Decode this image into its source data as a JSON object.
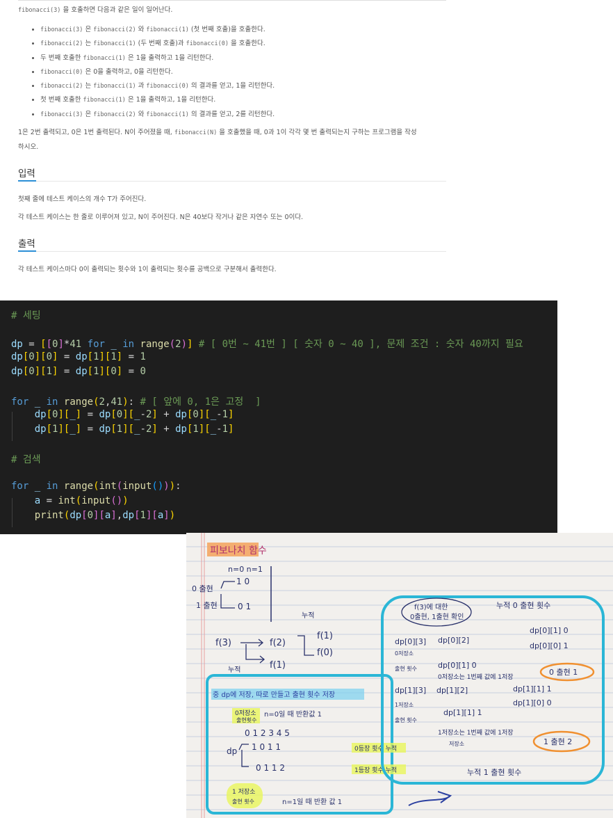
{
  "problem": {
    "intro": {
      "code": "fibonacci(3)",
      "text": " 을 호출하면 다음과 같은 일이 일어난다."
    },
    "bullets": [
      [
        {
          "c": "fibonacci(3)"
        },
        {
          "t": " 은 "
        },
        {
          "c": "fibonacci(2)"
        },
        {
          "t": " 와 "
        },
        {
          "c": "fibonacci(1)"
        },
        {
          "t": " (첫 번째 호출)을 호출한다."
        }
      ],
      [
        {
          "c": "fibonacci(2)"
        },
        {
          "t": " 는 "
        },
        {
          "c": "fibonacci(1)"
        },
        {
          "t": " (두 번째 호출)과 "
        },
        {
          "c": "fibonacci(0)"
        },
        {
          "t": " 을 호출한다."
        }
      ],
      [
        {
          "t": "두 번째 호출한 "
        },
        {
          "c": "fibonacci(1)"
        },
        {
          "t": " 은 1을 출력하고 1을 리턴한다."
        }
      ],
      [
        {
          "c": "fibonacci(0)"
        },
        {
          "t": " 은 0을 출력하고, 0을 리턴한다."
        }
      ],
      [
        {
          "c": "fibonacci(2)"
        },
        {
          "t": " 는 "
        },
        {
          "c": "fibonacci(1)"
        },
        {
          "t": " 과 "
        },
        {
          "c": "fibonacci(0)"
        },
        {
          "t": " 의 결과를 얻고, 1을 리턴한다."
        }
      ],
      [
        {
          "t": "첫 번째 호출한 "
        },
        {
          "c": "fibonacci(1)"
        },
        {
          "t": " 은 1을 출력하고, 1을 리턴한다."
        }
      ],
      [
        {
          "c": "fibonacci(3)"
        },
        {
          "t": " 은 "
        },
        {
          "c": "fibonacci(2)"
        },
        {
          "t": " 와 "
        },
        {
          "c": "fibonacci(1)"
        },
        {
          "t": " 의 결과를 얻고, 2를 리턴한다."
        }
      ]
    ],
    "summary_a": "1은 2번 출력되고, 0은 1번 출력된다. N이 주어졌을 때, ",
    "summary_code": "fibonacci(N)",
    "summary_b": " 을 호출했을 때, 0과 1이 각각 몇 번 출력되는지 구하는 프로그램을 작성",
    "summary_c": "하시오.",
    "input_heading": "입력",
    "input_line1": "첫째 줄에 테스트 케이스의 개수 T가 주어진다.",
    "input_line2": "각 테스트 케이스는 한 줄로 이루어져 있고, N이 주어진다. N은 40보다 작거나 같은 자연수 또는 0이다.",
    "output_heading": "출력",
    "output_line1": "각 테스트 케이스마다 0이 출력되는 횟수와 1이 출력되는 횟수를 공백으로 구분해서 출력한다."
  },
  "code_lines": [
    [
      {
        "k": "cm",
        "t": "# 세팅"
      }
    ],
    [],
    [
      {
        "k": "vr",
        "t": "dp"
      },
      {
        "k": "",
        "t": " = "
      },
      {
        "k": "y",
        "t": "["
      },
      {
        "k": "pk",
        "t": "["
      },
      {
        "k": "nm",
        "t": "0"
      },
      {
        "k": "pk",
        "t": "]"
      },
      {
        "k": "",
        "t": "*"
      },
      {
        "k": "nm",
        "t": "41"
      },
      {
        "k": "",
        "t": " "
      },
      {
        "k": "kw",
        "t": "for"
      },
      {
        "k": "",
        "t": " "
      },
      {
        "k": "vr",
        "t": "_"
      },
      {
        "k": "",
        "t": " "
      },
      {
        "k": "kw",
        "t": "in"
      },
      {
        "k": "",
        "t": " "
      },
      {
        "k": "fn",
        "t": "range"
      },
      {
        "k": "pk",
        "t": "("
      },
      {
        "k": "nm",
        "t": "2"
      },
      {
        "k": "pk",
        "t": ")"
      },
      {
        "k": "y",
        "t": "]"
      },
      {
        "k": "",
        "t": " "
      },
      {
        "k": "cm",
        "t": "# [ 0번 ~ 41번 ] [ 숫자 0 ~ 40 ], 문제 조건 : 숫자 40까지 필요"
      }
    ],
    [
      {
        "k": "vr",
        "t": "dp"
      },
      {
        "k": "y",
        "t": "["
      },
      {
        "k": "nm",
        "t": "0"
      },
      {
        "k": "y",
        "t": "]["
      },
      {
        "k": "nm",
        "t": "0"
      },
      {
        "k": "y",
        "t": "]"
      },
      {
        "k": "",
        "t": " = "
      },
      {
        "k": "vr",
        "t": "dp"
      },
      {
        "k": "y",
        "t": "["
      },
      {
        "k": "nm",
        "t": "1"
      },
      {
        "k": "y",
        "t": "]["
      },
      {
        "k": "nm",
        "t": "1"
      },
      {
        "k": "y",
        "t": "]"
      },
      {
        "k": "",
        "t": " = "
      },
      {
        "k": "nm",
        "t": "1"
      }
    ],
    [
      {
        "k": "vr",
        "t": "dp"
      },
      {
        "k": "y",
        "t": "["
      },
      {
        "k": "nm",
        "t": "0"
      },
      {
        "k": "y",
        "t": "]["
      },
      {
        "k": "nm",
        "t": "1"
      },
      {
        "k": "y",
        "t": "]"
      },
      {
        "k": "",
        "t": " = "
      },
      {
        "k": "vr",
        "t": "dp"
      },
      {
        "k": "y",
        "t": "["
      },
      {
        "k": "nm",
        "t": "1"
      },
      {
        "k": "y",
        "t": "]["
      },
      {
        "k": "nm",
        "t": "0"
      },
      {
        "k": "y",
        "t": "]"
      },
      {
        "k": "",
        "t": " = "
      },
      {
        "k": "nm",
        "t": "0"
      }
    ],
    [],
    [
      {
        "k": "kw",
        "t": "for"
      },
      {
        "k": "",
        "t": " "
      },
      {
        "k": "vr",
        "t": "_"
      },
      {
        "k": "",
        "t": " "
      },
      {
        "k": "kw",
        "t": "in"
      },
      {
        "k": "",
        "t": " "
      },
      {
        "k": "fn",
        "t": "range"
      },
      {
        "k": "y",
        "t": "("
      },
      {
        "k": "nm",
        "t": "2"
      },
      {
        "k": "",
        "t": ","
      },
      {
        "k": "nm",
        "t": "41"
      },
      {
        "k": "y",
        "t": ")"
      },
      {
        "k": "",
        "t": ": "
      },
      {
        "k": "cm",
        "t": "# [ 앞에 0, 1은 고정  ]"
      }
    ],
    [
      {
        "k": "",
        "t": "    "
      },
      {
        "k": "vr",
        "t": "dp"
      },
      {
        "k": "y",
        "t": "["
      },
      {
        "k": "nm",
        "t": "0"
      },
      {
        "k": "y",
        "t": "]["
      },
      {
        "k": "vr",
        "t": "_"
      },
      {
        "k": "y",
        "t": "]"
      },
      {
        "k": "",
        "t": " = "
      },
      {
        "k": "vr",
        "t": "dp"
      },
      {
        "k": "y",
        "t": "["
      },
      {
        "k": "nm",
        "t": "0"
      },
      {
        "k": "y",
        "t": "]["
      },
      {
        "k": "vr",
        "t": "_"
      },
      {
        "k": "",
        "t": "-"
      },
      {
        "k": "nm",
        "t": "2"
      },
      {
        "k": "y",
        "t": "]"
      },
      {
        "k": "",
        "t": " + "
      },
      {
        "k": "vr",
        "t": "dp"
      },
      {
        "k": "y",
        "t": "["
      },
      {
        "k": "nm",
        "t": "0"
      },
      {
        "k": "y",
        "t": "]["
      },
      {
        "k": "vr",
        "t": "_"
      },
      {
        "k": "",
        "t": "-"
      },
      {
        "k": "nm",
        "t": "1"
      },
      {
        "k": "y",
        "t": "]"
      }
    ],
    [
      {
        "k": "",
        "t": "    "
      },
      {
        "k": "vr",
        "t": "dp"
      },
      {
        "k": "y",
        "t": "["
      },
      {
        "k": "nm",
        "t": "1"
      },
      {
        "k": "y",
        "t": "]["
      },
      {
        "k": "vr",
        "t": "_"
      },
      {
        "k": "y",
        "t": "]"
      },
      {
        "k": "",
        "t": " = "
      },
      {
        "k": "vr",
        "t": "dp"
      },
      {
        "k": "y",
        "t": "["
      },
      {
        "k": "nm",
        "t": "1"
      },
      {
        "k": "y",
        "t": "]["
      },
      {
        "k": "vr",
        "t": "_"
      },
      {
        "k": "",
        "t": "-"
      },
      {
        "k": "nm",
        "t": "2"
      },
      {
        "k": "y",
        "t": "]"
      },
      {
        "k": "",
        "t": " + "
      },
      {
        "k": "vr",
        "t": "dp"
      },
      {
        "k": "y",
        "t": "["
      },
      {
        "k": "nm",
        "t": "1"
      },
      {
        "k": "y",
        "t": "]["
      },
      {
        "k": "vr",
        "t": "_"
      },
      {
        "k": "",
        "t": "-"
      },
      {
        "k": "nm",
        "t": "1"
      },
      {
        "k": "y",
        "t": "]"
      }
    ],
    [],
    [
      {
        "k": "cm",
        "t": "# 검색"
      }
    ],
    [],
    [
      {
        "k": "kw",
        "t": "for"
      },
      {
        "k": "",
        "t": " "
      },
      {
        "k": "vr",
        "t": "_"
      },
      {
        "k": "",
        "t": " "
      },
      {
        "k": "kw",
        "t": "in"
      },
      {
        "k": "",
        "t": " "
      },
      {
        "k": "fn",
        "t": "range"
      },
      {
        "k": "y",
        "t": "("
      },
      {
        "k": "fn",
        "t": "int"
      },
      {
        "k": "pk",
        "t": "("
      },
      {
        "k": "fn",
        "t": "input"
      },
      {
        "k": "bl",
        "t": "()"
      },
      {
        "k": "pk",
        "t": ")"
      },
      {
        "k": "y",
        "t": ")"
      },
      {
        "k": "",
        "t": ":"
      }
    ],
    [
      {
        "k": "",
        "t": "    "
      },
      {
        "k": "vr",
        "t": "a"
      },
      {
        "k": "",
        "t": " = "
      },
      {
        "k": "fn",
        "t": "int"
      },
      {
        "k": "y",
        "t": "("
      },
      {
        "k": "fn",
        "t": "input"
      },
      {
        "k": "pk",
        "t": "()"
      },
      {
        "k": "y",
        "t": ")"
      }
    ],
    [
      {
        "k": "",
        "t": "    "
      },
      {
        "k": "fn",
        "t": "print"
      },
      {
        "k": "y",
        "t": "("
      },
      {
        "k": "vr",
        "t": "dp"
      },
      {
        "k": "pk",
        "t": "["
      },
      {
        "k": "nm",
        "t": "0"
      },
      {
        "k": "pk",
        "t": "]["
      },
      {
        "k": "vr",
        "t": "a"
      },
      {
        "k": "pk",
        "t": "]"
      },
      {
        "k": "",
        "t": ","
      },
      {
        "k": "vr",
        "t": "dp"
      },
      {
        "k": "pk",
        "t": "["
      },
      {
        "k": "nm",
        "t": "1"
      },
      {
        "k": "pk",
        "t": "]["
      },
      {
        "k": "vr",
        "t": "a"
      },
      {
        "k": "pk",
        "t": "]"
      },
      {
        "k": "y",
        "t": ")"
      }
    ]
  ],
  "code_colors": {
    "cm": "#6a9955",
    "kw": "#569cd6",
    "fn": "#dcdcaa",
    "vr": "#9cdcfe",
    "nm": "#b5cea8",
    "y": "#ffd700",
    "pk": "#da70d6",
    "bl": "#179fff"
  },
  "notes": {
    "title": "피보나치 함수",
    "n_hdr": "n=0  n=1",
    "row0_label": "0 출현",
    "row0_vals": "1   0",
    "row1_label": "1 출현",
    "row1_vals": "0   1",
    "f3": "f(3)",
    "f2": "f(2)",
    "f1": "f(1)",
    "f1b": "f(1)",
    "f0": "f(0)",
    "nujeok_top": "누적",
    "nujeok_left": "누적",
    "box_title": "중 dp에 저장, 따로 만들고 출현 횟수 저장",
    "save0": "0저장소",
    "appear_cnt": "출현횟수",
    "n0_ret": "n=0일 때 반환값 1",
    "cols": "0   1   2   3   4   5",
    "dp_lbl": "dp",
    "row0": "1  0   1    1",
    "row0_note": "0등장 횟수 누적",
    "row1": "0   1   1    2",
    "row1_note": "1등장 횟수 누적",
    "save1": "1 저장소",
    "appear_cnt2": "출현 횟수",
    "n1_ret": "n=1일 때 반환 값 1",
    "circle_a": "f(3)에 대한",
    "circle_b": "0출현, 1출현 확인",
    "top_note": "누적 0 출현 횟수",
    "dp03": "dp[0][3]",
    "dp02": "dp[0][2]",
    "dp01a": "dp[0][1] 0",
    "dp00a": "dp[0][0] 1",
    "dp01b": "dp[0][1] 0",
    "save0b": "0저장소",
    "cnt0b": "출현 횟수",
    "note0": "0저장소는 1번째 값에 1저장",
    "out0": "0 출현 1",
    "dp13": "dp[1][3]",
    "dp12": "dp[1][2]",
    "dp11a": "dp[1][1] 1",
    "dp10a": "dp[1][0] 0",
    "dp11b": "dp[1][1]  1",
    "save1b": "1저장소",
    "cnt1b": "출현 횟수",
    "note1": "1저장소는 1번째 값에 1저장",
    "save1c": "저장소",
    "bottom_note": "누적 1 출현 횟수",
    "out1": "1 출현 2"
  }
}
